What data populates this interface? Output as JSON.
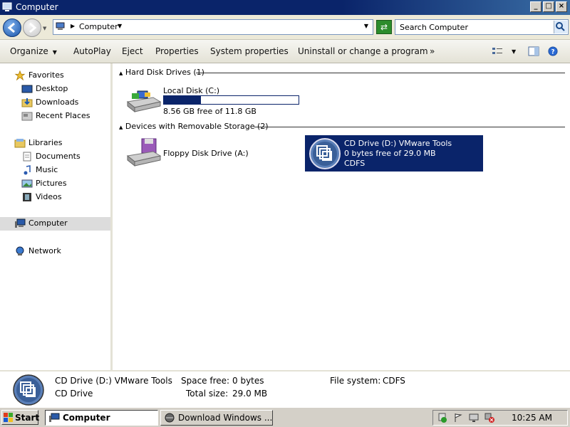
{
  "window": {
    "title": "Computer"
  },
  "address": {
    "location": "Computer",
    "search_placeholder": "Search Computer"
  },
  "command_bar": {
    "items": [
      "Organize",
      "AutoPlay",
      "Eject",
      "Properties",
      "System properties",
      "Uninstall or change a program"
    ],
    "more": "»"
  },
  "nav": {
    "favorites": {
      "label": "Favorites",
      "items": [
        "Desktop",
        "Downloads",
        "Recent Places"
      ]
    },
    "libraries": {
      "label": "Libraries",
      "items": [
        "Documents",
        "Music",
        "Pictures",
        "Videos"
      ]
    },
    "computer": "Computer",
    "network": "Network"
  },
  "content": {
    "hard_disk_group": "Hard Disk Drives (1)",
    "local_disk": {
      "name": "Local Disk (C:)",
      "free_text": "8.56 GB free of 11.8 GB",
      "used_fraction": 0.275
    },
    "removable_group": "Devices with Removable Storage (2)",
    "floppy": {
      "name": "Floppy Disk Drive (A:)"
    },
    "cd": {
      "name": "CD Drive (D:) VMware Tools",
      "free_text": "0 bytes free of 29.0 MB",
      "fs": "CDFS"
    }
  },
  "details": {
    "name": "CD Drive (D:) VMware Tools",
    "type": "CD Drive",
    "space_free_label": "Space free:",
    "space_free_value": "0 bytes",
    "total_size_label": "Total size:",
    "total_size_value": "29.0 MB",
    "fs_label": "File system:",
    "fs_value": "CDFS"
  },
  "taskbar": {
    "start": "Start",
    "tasks": [
      "Computer",
      "Download Windows ..."
    ],
    "clock": "10:25 AM"
  }
}
